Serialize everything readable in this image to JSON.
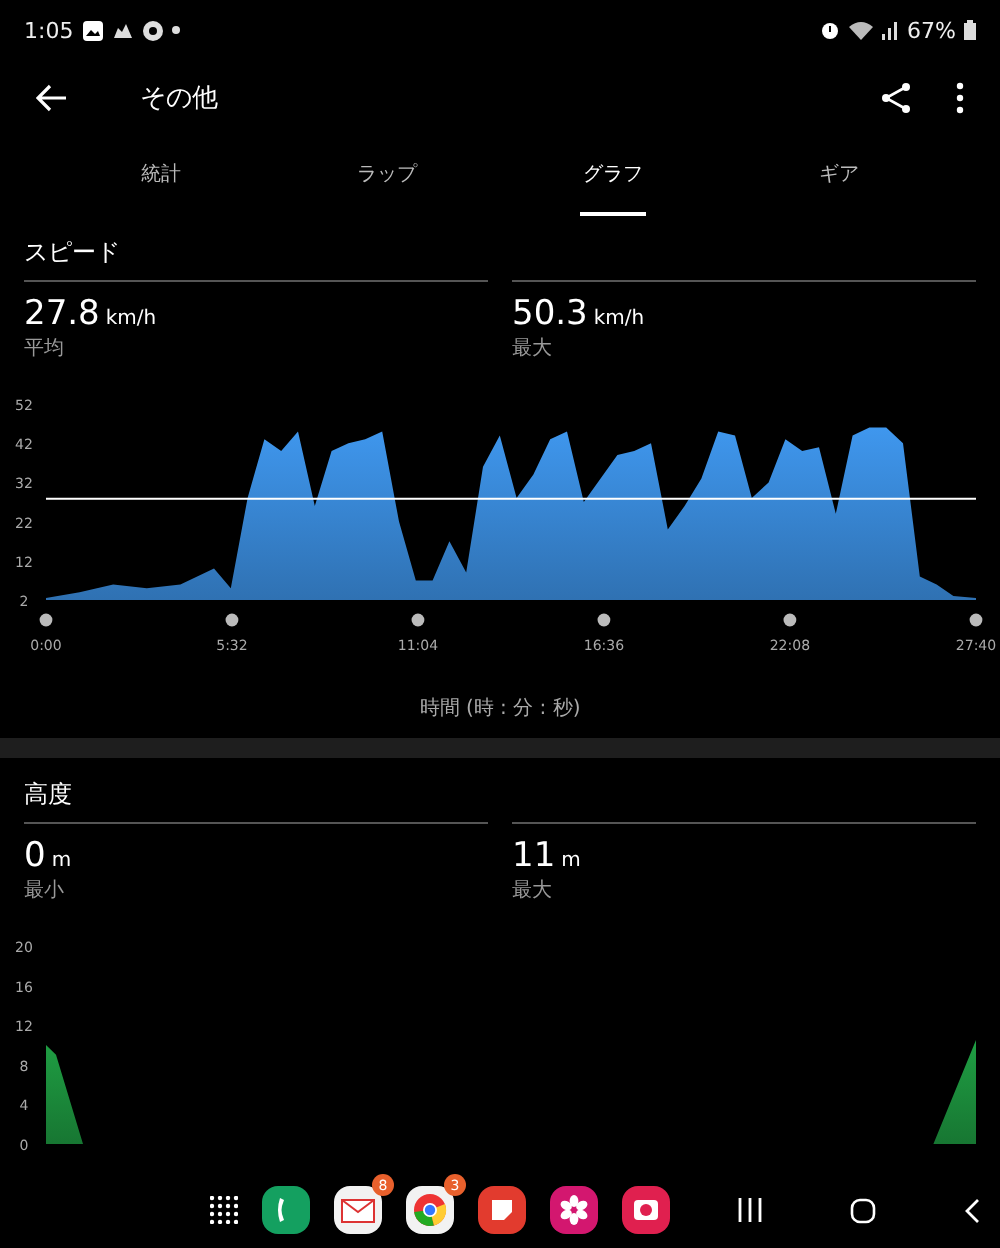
{
  "status_bar": {
    "time": "1:05",
    "battery": "67%"
  },
  "app_bar": {
    "title": "その他"
  },
  "tabs": [
    {
      "label": "統計",
      "selected": false
    },
    {
      "label": "ラップ",
      "selected": false
    },
    {
      "label": "グラフ",
      "selected": true
    },
    {
      "label": "ギア",
      "selected": false
    }
  ],
  "sections": [
    {
      "title": "スピード",
      "stats": [
        {
          "value": "27.8",
          "unit": "km/h",
          "label": "平均"
        },
        {
          "value": "50.3",
          "unit": "km/h",
          "label": "最大"
        }
      ],
      "chart_data": {
        "type": "area",
        "xlabel": "時間 (時 : 分 : 秒)",
        "color": "#3f97ee",
        "x": [
          0,
          1,
          2,
          3,
          4,
          5,
          5.5,
          6,
          6.5,
          7,
          7.5,
          8,
          8.5,
          9,
          9.5,
          10,
          10.5,
          11,
          11.5,
          12,
          12.5,
          13,
          13.5,
          14,
          14.5,
          15,
          15.5,
          16,
          16.5,
          17,
          17.5,
          18,
          18.5,
          19,
          19.5,
          20,
          20.5,
          21,
          21.5,
          22,
          22.5,
          23,
          23.5,
          24,
          24.5,
          25,
          25.5,
          26,
          26.5,
          27,
          27.67
        ],
        "values": [
          2.5,
          4,
          6,
          5,
          6,
          10,
          5,
          28,
          43,
          40,
          45,
          26,
          40,
          42,
          43,
          45,
          22,
          7,
          7,
          17,
          9,
          36,
          44,
          28,
          34,
          43,
          45,
          27,
          33,
          39,
          40,
          42,
          20,
          26,
          33,
          45,
          44,
          28,
          32,
          43,
          40,
          41,
          24,
          44,
          46,
          46,
          42,
          8,
          6,
          3,
          2.5
        ],
        "xlim": [
          0,
          27.67
        ],
        "ylim": [
          2,
          52
        ],
        "yticks": [
          2,
          12,
          22,
          32,
          42,
          52
        ],
        "xticks": [
          {
            "value": 0,
            "label": "0:00"
          },
          {
            "value": 5.533,
            "label": "5:32"
          },
          {
            "value": 11.067,
            "label": "11:04"
          },
          {
            "value": 16.6,
            "label": "16:36"
          },
          {
            "value": 22.133,
            "label": "22:08"
          },
          {
            "value": 27.67,
            "label": "27:40"
          }
        ],
        "ref_lines": [
          {
            "axis": "y",
            "value": 27.8
          }
        ]
      }
    },
    {
      "title": "高度",
      "stats": [
        {
          "value": "0",
          "unit": "m",
          "label": "最小"
        },
        {
          "value": "11",
          "unit": "m",
          "label": "最大"
        }
      ],
      "chart_data": {
        "type": "area",
        "color": "#1f9e43",
        "x": [
          0,
          0.3,
          1.1,
          2,
          26.4,
          27.67
        ],
        "values": [
          10,
          9,
          0,
          0,
          0,
          10.5
        ],
        "xlim": [
          0,
          27.67
        ],
        "ylim": [
          0,
          20
        ],
        "yticks": [
          0,
          4,
          8,
          12,
          16,
          20
        ]
      }
    }
  ],
  "dock": {
    "apps": [
      {
        "kind": "drawer"
      },
      {
        "kind": "phone"
      },
      {
        "kind": "mail",
        "badge": "8"
      },
      {
        "kind": "browser",
        "badge": "3"
      },
      {
        "kind": "notes"
      },
      {
        "kind": "flower"
      },
      {
        "kind": "camera"
      }
    ]
  }
}
